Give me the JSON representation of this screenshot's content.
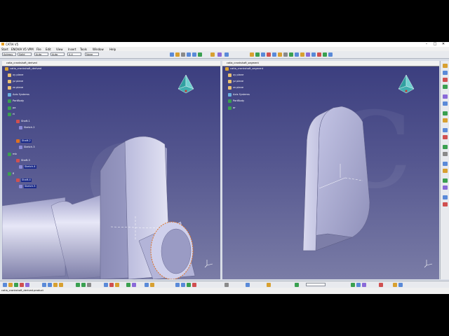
{
  "window": {
    "title": "CATIA V5"
  },
  "menu": [
    "Start",
    "ENOVIA V5 VPM",
    "File",
    "Edit",
    "View",
    "Insert",
    "Tools",
    "Window",
    "Help"
  ],
  "toolbar": {
    "sel1": "Axlessy",
    "sel2": "Solid",
    "sel3": "Auto",
    "sel4": "Auto",
    "sel5": "4-4",
    "sel6": "None"
  },
  "left_view": {
    "title": "catia_crankshaft_derived",
    "tree": [
      {
        "label": "catia_crankshaft_derived",
        "type": "part"
      },
      {
        "label": "xy plane",
        "type": "plane"
      },
      {
        "label": "yz plane",
        "type": "plane"
      },
      {
        "label": "zx plane",
        "type": "plane"
      },
      {
        "label": "Axis Systems",
        "type": "set"
      },
      {
        "label": "PartBody",
        "type": "body"
      },
      {
        "label": "pa",
        "type": "feature"
      },
      {
        "label": "rt",
        "type": "feature"
      },
      {
        "label": "Shaft.1",
        "type": "shaft"
      },
      {
        "label": "Sketch.2",
        "type": "sketch"
      },
      {
        "label": "Shaft.2",
        "type": "shaft",
        "selected": true
      },
      {
        "label": "Sketch.3",
        "type": "sketch"
      },
      {
        "label": "mb",
        "type": "feature"
      },
      {
        "label": "Shaft.3",
        "type": "shaft"
      },
      {
        "label": "Sketch.4",
        "type": "sketch",
        "selected": true
      },
      {
        "label": "fl",
        "type": "feature"
      },
      {
        "label": "Shaft.4",
        "type": "shaft",
        "selected": true
      },
      {
        "label": "Sketch.5",
        "type": "sketch",
        "selected": true
      }
    ]
  },
  "right_view": {
    "title": "catia_crankshaft_segment",
    "tree": [
      {
        "label": "catia_crankshaft_segment",
        "type": "part"
      },
      {
        "label": "xy plane",
        "type": "plane"
      },
      {
        "label": "yz plane",
        "type": "plane"
      },
      {
        "label": "zx plane",
        "type": "plane"
      },
      {
        "label": "Axis Systems",
        "type": "set"
      },
      {
        "label": "PartBody",
        "type": "body"
      },
      {
        "label": "ar",
        "type": "feature"
      }
    ]
  },
  "status": {
    "text": "catia_crankshaft_derived.product"
  },
  "command_input": {
    "value": ""
  },
  "colors": {
    "viewport_top": "#3a3d7e",
    "viewport_bottom": "#7a7ca6",
    "part": "#c8c9e6",
    "selection": "#1a2a8a",
    "highlight": "#e07020"
  }
}
